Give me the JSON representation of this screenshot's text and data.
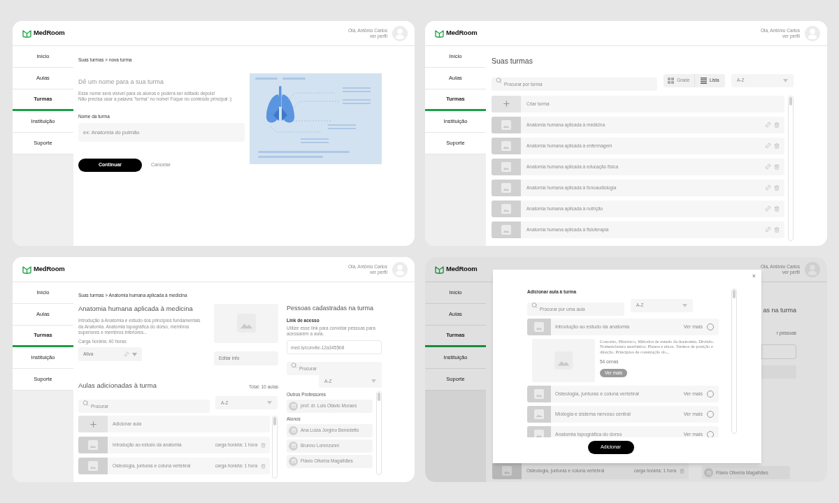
{
  "screens": [
    {
      "kind": "new_class",
      "header": {
        "logo": "MedRoom",
        "greeting": "Olá, Antônio Carlos",
        "profile_link": "ver perfil"
      },
      "nav": [
        {
          "label": "Início",
          "selected": false
        },
        {
          "label": "Aulas",
          "selected": false
        },
        {
          "label": "Turmas",
          "selected": true
        },
        {
          "label": "Instituição",
          "selected": false
        },
        {
          "label": "Suporte",
          "selected": false
        }
      ],
      "breadcrumb": "Suas turmas > nova turma",
      "heading": "Dê um nome para a sua turma",
      "help": [
        "Esse nome será visível para os alunos e poderá ser editado depois!",
        "Não precisa usar a palavra \"turma\" no nome! Foque no conteúdo principal :)"
      ],
      "field": {
        "label": "Nome da turma",
        "placeholder": "ex: Anatomia do pulmão"
      },
      "buttons": [
        {
          "label": "Continuar",
          "kind": "primary"
        },
        {
          "label": "Cancelar",
          "kind": "link"
        }
      ]
    },
    {
      "kind": "class_list",
      "header": {
        "logo": "MedRoom",
        "greeting": "Olá, Antônio Carlos",
        "profile_link": "ver perfil"
      },
      "nav": [
        {
          "label": "Início",
          "selected": false
        },
        {
          "label": "Aulas",
          "selected": false
        },
        {
          "label": "Turmas",
          "selected": true
        },
        {
          "label": "Instituição",
          "selected": false
        },
        {
          "label": "Suporte",
          "selected": false
        }
      ],
      "title": "Suas turmas",
      "search": {
        "placeholder": "Procurar por turma"
      },
      "view_toggle": [
        {
          "label": "Grade",
          "kind": "grid",
          "selected": false
        },
        {
          "label": "Lista",
          "kind": "list",
          "selected": true
        }
      ],
      "sort": "A-Z",
      "create_label": "Criar turma",
      "classes": [
        "Anatomia humana aplicada à medicina",
        "Anatomia humana aplicada à enfermagem",
        "Anatomia humana aplicada à educação física",
        "Anatomia humana aplicada à fonoaudiologia",
        "Anatomia humana aplicada à nutrição",
        "Anatomia humana aplicada à fisioterapia"
      ]
    },
    {
      "kind": "class_detail",
      "header": {
        "logo": "MedRoom",
        "greeting": "Olá, Antônio Carlos",
        "profile_link": "ver perfil"
      },
      "nav": [
        {
          "label": "Início",
          "selected": false
        },
        {
          "label": "Aulas",
          "selected": false
        },
        {
          "label": "Turmas",
          "selected": true
        },
        {
          "label": "Instituição",
          "selected": false
        },
        {
          "label": "Suporte",
          "selected": false
        }
      ],
      "breadcrumb": "Suas turmas > Anatomia humana aplicada à medicina",
      "title": "Anatomia humana aplicada à medicina",
      "description": "Introdução à Anatomia e estudo dos princípios fundamentais da Anatomia. Anatomia topográfica do dorso, membros superiores e membros inferiores...",
      "workload": "Carga horária: 40 horas",
      "status": "Ativa",
      "edit_button": "Editar info",
      "lessons": {
        "title": "Aulas adicionadas à turma",
        "total": "Total: 10 aulas",
        "search_placeholder": "Procurar",
        "sort": "A-Z",
        "add_label": "Adicionar aula",
        "items": [
          {
            "title": "Introdução ao estudo da anatomia",
            "workload": "carga horária: 1 hora"
          },
          {
            "title": "Osteologia, junturas e coluna vertebral",
            "workload": "carga horária: 1 hora"
          }
        ]
      },
      "people": {
        "title": "Pessoas cadastradas na turma",
        "link_title": "Link de acesso",
        "link_help": "Utilize esse link para convidar pessoas para acessarem a aula.",
        "link": "med.ly/convite-12a3455b8",
        "search_placeholder": "Procurar",
        "sort": "A-Z",
        "groups": [
          {
            "title": "Outros Professores",
            "people": [
              "prof. dr. Luís Otávio Moraes"
            ]
          },
          {
            "title": "Alunos",
            "people": [
              "Ana Luiza Jorgino Benedetto",
              "Brunno Lorenzonni",
              "Flávio Oliveira Magalhães"
            ]
          }
        ]
      }
    },
    {
      "kind": "add_lesson_modal",
      "header": {
        "logo": "MedRoom",
        "greeting": "Olá, Antônio Carlos",
        "profile_link": "ver perfil"
      },
      "nav": [
        {
          "label": "Início",
          "selected": false
        },
        {
          "label": "Aulas",
          "selected": false
        },
        {
          "label": "Turmas",
          "selected": true
        },
        {
          "label": "Instituição",
          "selected": false
        },
        {
          "label": "Suporte",
          "selected": false
        }
      ],
      "behind": {
        "title_fragment": "as na turma",
        "help_fragment": "r pessoas",
        "lesson": {
          "title": "Osteologia, junturas e coluna vertebral",
          "workload": "carga horária: 1 hora"
        },
        "person": "Flávio Oliveira Magalhães"
      },
      "modal": {
        "close": "×",
        "title": "Adicionar aula à turma",
        "search_placeholder": "Procurar por uma aula",
        "sort": "A-Z",
        "lessons": [
          {
            "title": "Introdução ao estudo da anatomia",
            "more": "Ver mais",
            "selected": false,
            "description": "Conceito, Histórico, Métodos de estudo da Anatomia. Divisão. Nomenclatura anatômica. Planos e eixos. Termos de posição e direção. Princípios de construção do...",
            "scenes": "54 cenas",
            "more_button": "Ver mais"
          },
          {
            "title": "Osteologia, junturas e coluna vertebral",
            "more": "Ver mais",
            "selected": false
          },
          {
            "title": "Miologia e sistema nervoso central",
            "more": "Ver mais",
            "selected": false
          },
          {
            "title": "Anatomia topográfica do dorso",
            "more": "Ver mais",
            "selected": false
          }
        ],
        "submit": "Adicionar"
      }
    }
  ]
}
